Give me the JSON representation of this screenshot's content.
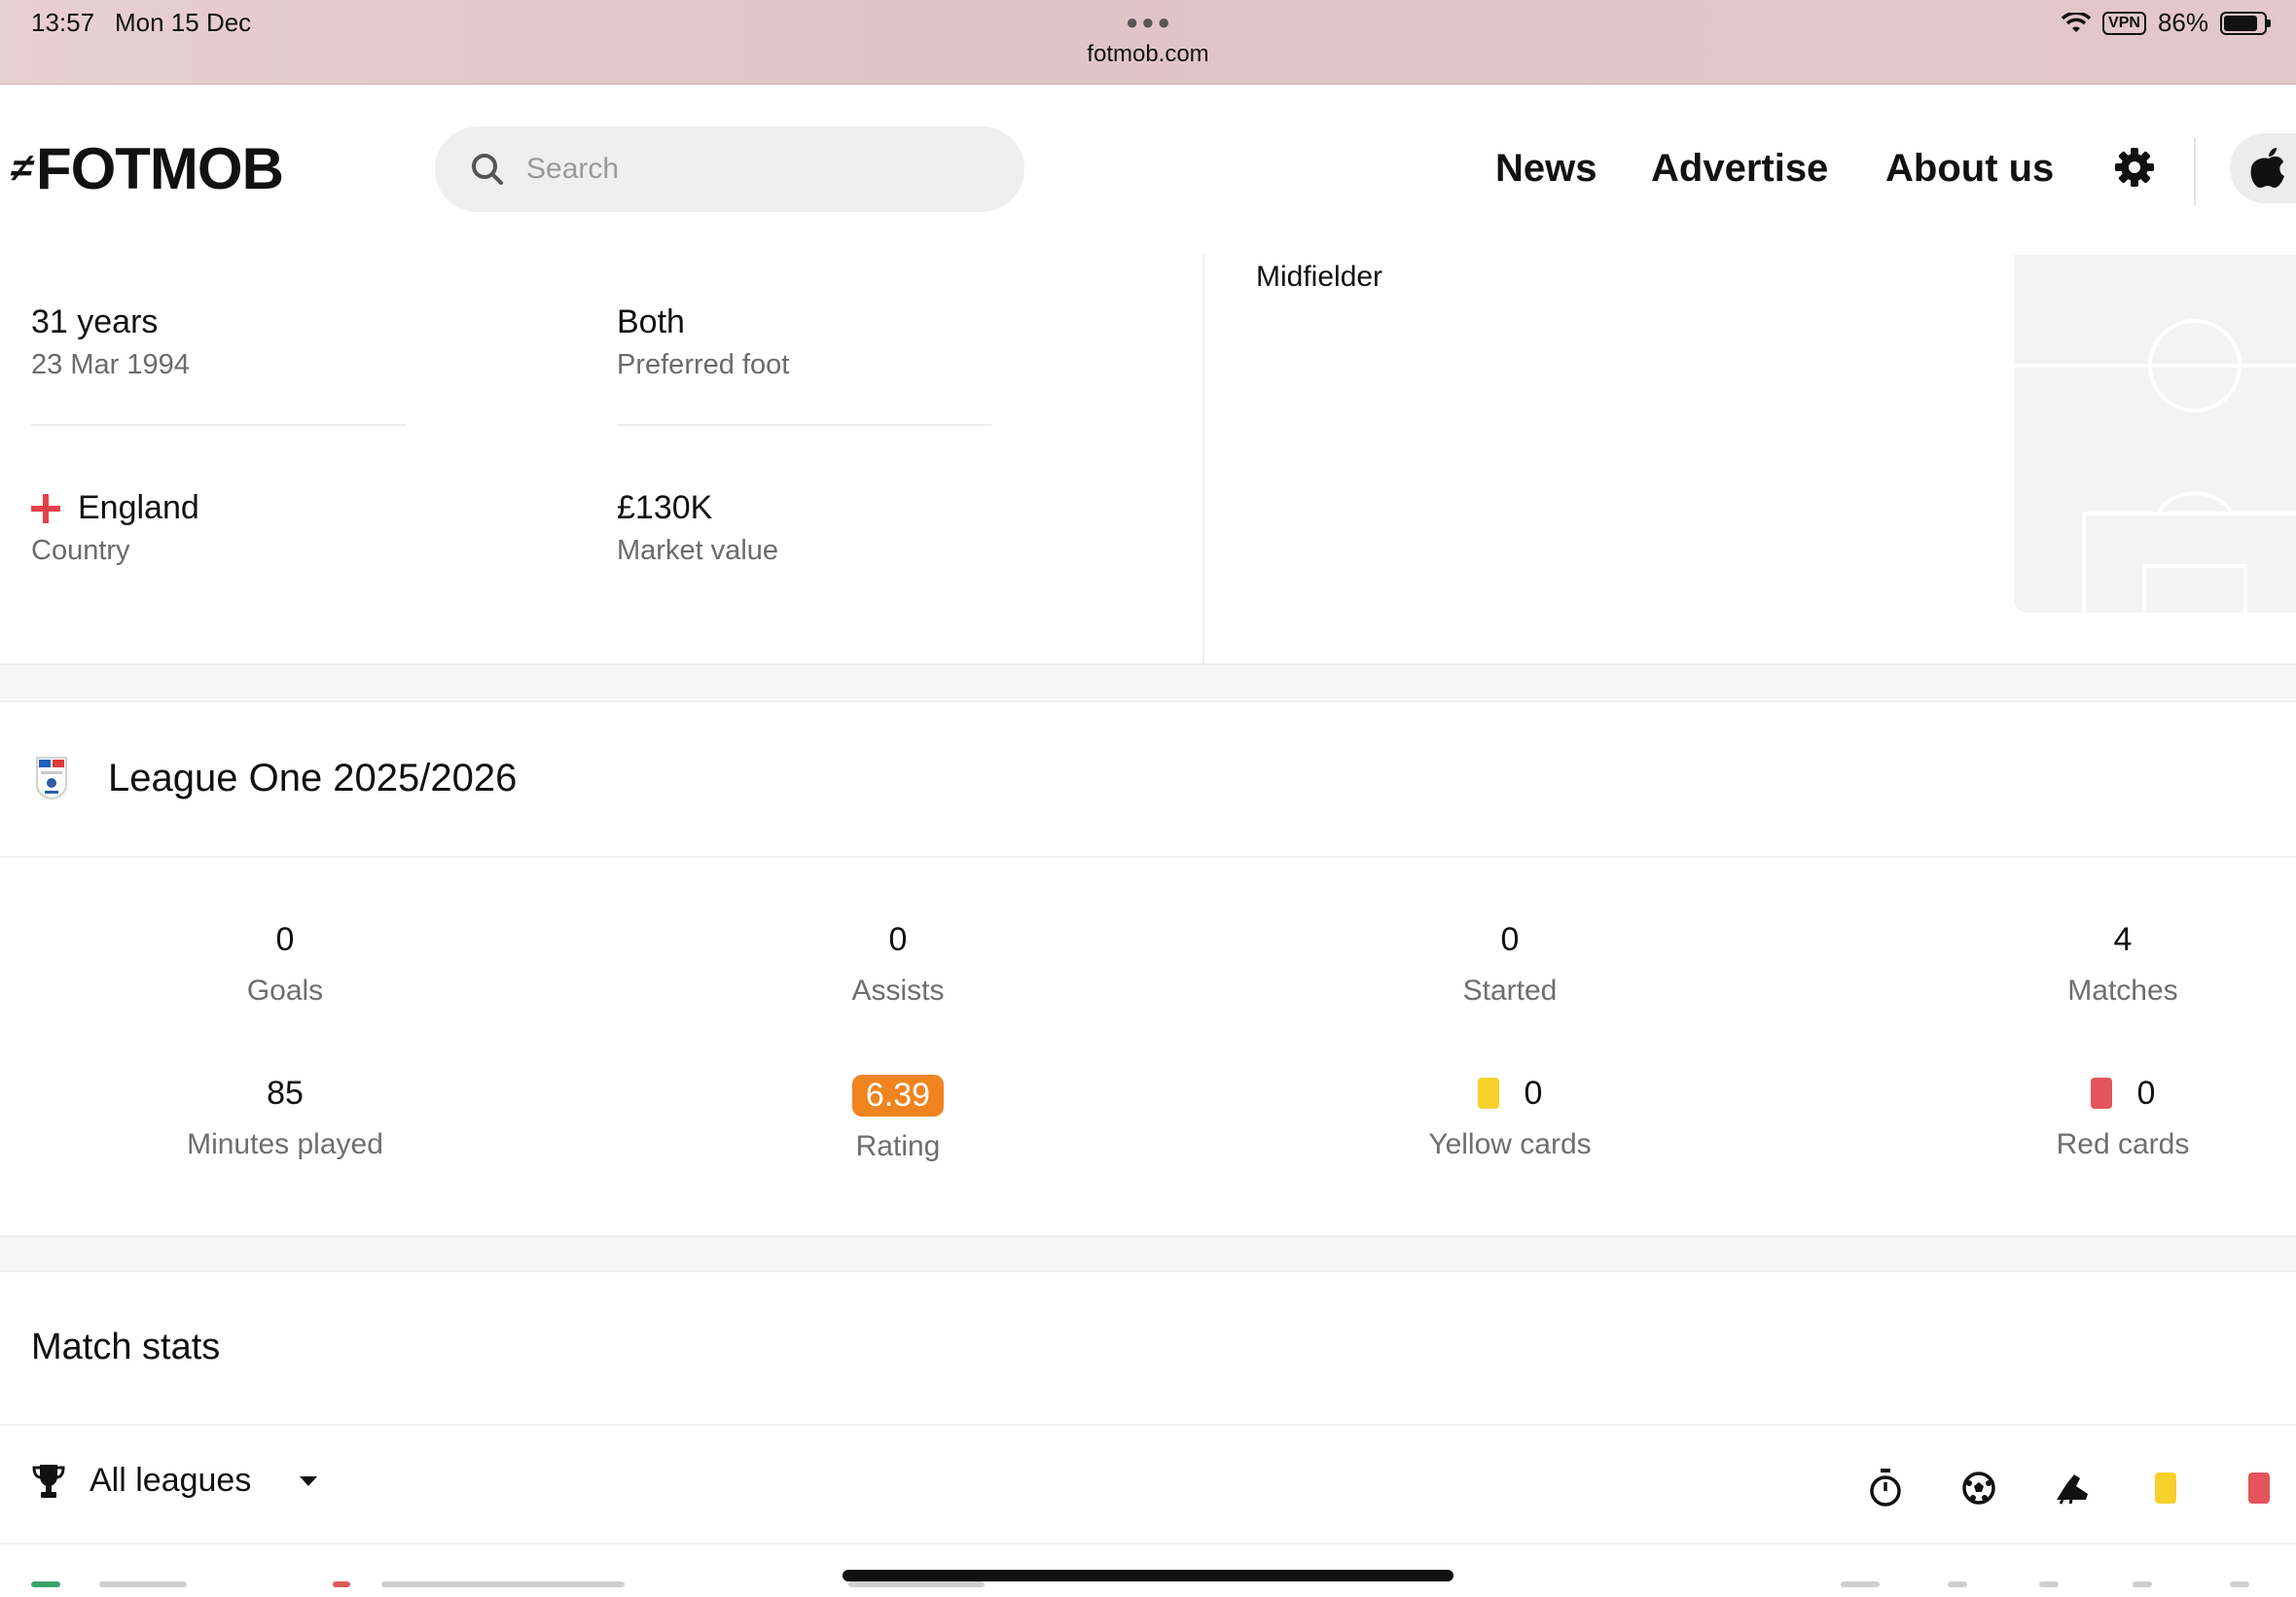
{
  "status_bar": {
    "time": "13:57",
    "date": "Mon 15 Dec",
    "url": "fotmob.com",
    "vpn": "VPN",
    "battery": "86%"
  },
  "header": {
    "logo": "FOTMOB",
    "search_placeholder": "Search",
    "nav": [
      "News",
      "Advertise",
      "About us"
    ]
  },
  "player_info": {
    "age": {
      "value": "31 years",
      "label": "23 Mar 1994"
    },
    "foot": {
      "value": "Both",
      "label": "Preferred foot"
    },
    "country": {
      "value": "England",
      "label": "Country"
    },
    "market_value": {
      "value": "£130K",
      "label": "Market value"
    },
    "position": "Midfielder"
  },
  "league": {
    "title": "League One 2025/2026",
    "stats": [
      {
        "value": "0",
        "label": "Goals"
      },
      {
        "value": "0",
        "label": "Assists"
      },
      {
        "value": "0",
        "label": "Started"
      },
      {
        "value": "4",
        "label": "Matches"
      },
      {
        "value": "85",
        "label": "Minutes played"
      },
      {
        "value": "6.39",
        "label": "Rating"
      },
      {
        "value": "0",
        "label": "Yellow cards"
      },
      {
        "value": "0",
        "label": "Red cards"
      }
    ]
  },
  "match_stats": {
    "title": "Match stats",
    "filter": "All leagues",
    "column_icons": [
      "stopwatch-icon",
      "football-icon",
      "boot-icon",
      "yellow-card-icon",
      "red-card-icon"
    ]
  },
  "colors": {
    "rating": "#f0841f",
    "yellow_card": "#f7d02c",
    "red_card": "#e5545b",
    "england_cross": "#e5414a"
  }
}
